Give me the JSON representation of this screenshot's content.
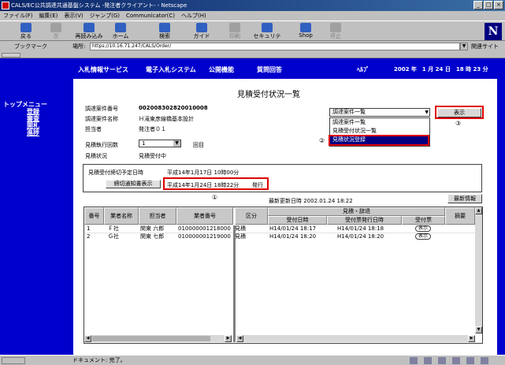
{
  "window": {
    "title": "CALS/EC公共調達共通基盤システム -発注者クライアント- - Netscape",
    "controls": [
      "_",
      "□",
      "×"
    ]
  },
  "menu": [
    "ファイル(F)",
    "編集(E)",
    "表示(V)",
    "ジャンプ(G)",
    "Communicator(C)",
    "ヘルプ(H)"
  ],
  "toolbar": {
    "back": "戻る",
    "forward": "次",
    "reload": "再読み込み",
    "home": "ホーム",
    "search": "検索",
    "guide": "ガイド",
    "print": "印刷",
    "security": "セキュリティ",
    "shop": "Shop",
    "stop": "停止"
  },
  "location": {
    "bookmarks": "ブックマーク",
    "label": "場所:",
    "url": "https://10.16.71.247/CALS/Order/",
    "related": "関連サイト"
  },
  "topnav": {
    "items": [
      "入札情報サービス",
      "電子入札システム",
      "公開機能",
      "質問回答",
      "ﾍﾙﾌﾟ"
    ],
    "date": "2002 年　1 月 24 日　18 時 23 分"
  },
  "leftmenu": {
    "head": "トップメニュー",
    "items": [
      "登録",
      "審査",
      "開札",
      "進捗"
    ]
  },
  "page": {
    "title": "見積受付状況一覧",
    "fields": {
      "case_no_label": "調達案件番号",
      "case_no": "002008302820010008",
      "case_name_label": "調達案件名称",
      "case_name": "Ｈ滝東彦線橋基本設計",
      "person_label": "担当者",
      "person": "発注者０１",
      "times_label": "見積執行回数",
      "times": "1",
      "times_suffix": "回目",
      "status_label": "見積状況",
      "status": "見積受付中"
    },
    "case_select": {
      "selected": "調達案件一覧",
      "options": [
        "調達案件一覧",
        "見積受付状況一覧",
        "見積状況登録"
      ]
    },
    "show_button": "表示",
    "markers": [
      "①",
      "②",
      "③"
    ],
    "deadline_label": "見積受付締切予定日時",
    "deadline": "平成14年1月17日 10時00分",
    "notify_button": "締切通知書表示",
    "notify_date": "平成14年1月24日 18時22分",
    "notify_issued": "発行",
    "updated": "最新更新日時 2002.01.24 18:22",
    "latest_button": "最新情報"
  },
  "table": {
    "headers": {
      "no": "番号",
      "company": "業者名称",
      "person": "担当者",
      "company_no": "業者番号",
      "type": "区分",
      "group": "見積・辞退",
      "received": "受付日時",
      "issued": "受付票発行日時",
      "slip": "受付票",
      "remarks": "摘要"
    },
    "rows": [
      {
        "no": "1",
        "company": "Ｆ社",
        "person": "関東 六郎",
        "company_no": "010000001218000",
        "type": "見積",
        "received": "H14/01/24 18:17",
        "issued": "H14/01/24 18:18",
        "slip": "表示"
      },
      {
        "no": "2",
        "company": "Ｇ社",
        "person": "関東 七郎",
        "company_no": "010000001219000",
        "type": "見積",
        "received": "H14/01/24 18:20",
        "issued": "H14/01/24 18:20",
        "slip": "表示"
      }
    ]
  },
  "statusbar": {
    "text": "ドキュメント: 完了。"
  },
  "colors": {
    "nav_blue": "#0000cc",
    "highlight_red": "#e00000",
    "selected_option": "#000080"
  }
}
